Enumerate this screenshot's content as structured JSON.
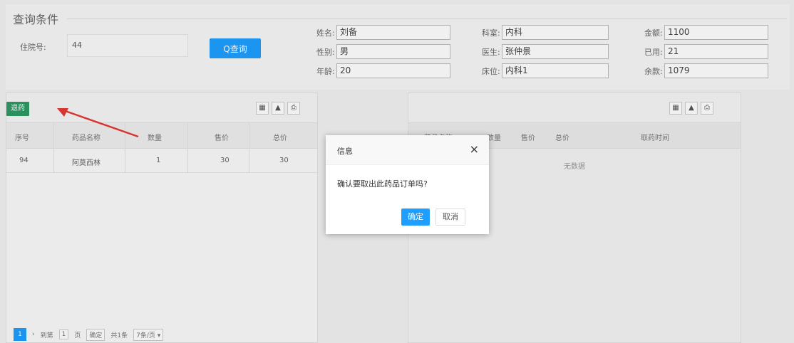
{
  "query": {
    "title": "查询条件",
    "zyh_label": "住院号:",
    "zyh_value": "44",
    "search_button": "Q查询",
    "fields": [
      {
        "label": "姓名:",
        "value": "刘备"
      },
      {
        "label": "性别:",
        "value": "男"
      },
      {
        "label": "年龄:",
        "value": "20"
      },
      {
        "label": "科室:",
        "value": "内科"
      },
      {
        "label": "医生:",
        "value": "张仲景"
      },
      {
        "label": "床位:",
        "value": "内科1"
      },
      {
        "label": "金额:",
        "value": "1100"
      },
      {
        "label": "已用:",
        "value": "21"
      },
      {
        "label": "余款:",
        "value": "1079"
      }
    ]
  },
  "left_table": {
    "toolbar_button": "退药",
    "headers": [
      "序号",
      "药品名称",
      "数量",
      "售价",
      "总价"
    ],
    "rows": [
      [
        "94",
        "阿莫西林",
        "1",
        "30",
        "30"
      ]
    ],
    "pager": {
      "current_page": "1",
      "goto_label": "到第",
      "page_input": "1",
      "page_unit": "页",
      "ok_label": "确定",
      "total": "共1条",
      "per_page": "7条/页 ▾"
    }
  },
  "right_table": {
    "headers": [
      "药品名称",
      "数量",
      "售价",
      "总价",
      "取药时间"
    ],
    "empty_text": "无数据"
  },
  "dialog": {
    "title": "信息",
    "close": "×",
    "message": "确认要取出此药品订单吗?",
    "ok": "确定",
    "cancel": "取消"
  },
  "colors": {
    "primary": "#1e9fff",
    "return_button": "#2f9a64",
    "arrow": "#e53935"
  }
}
